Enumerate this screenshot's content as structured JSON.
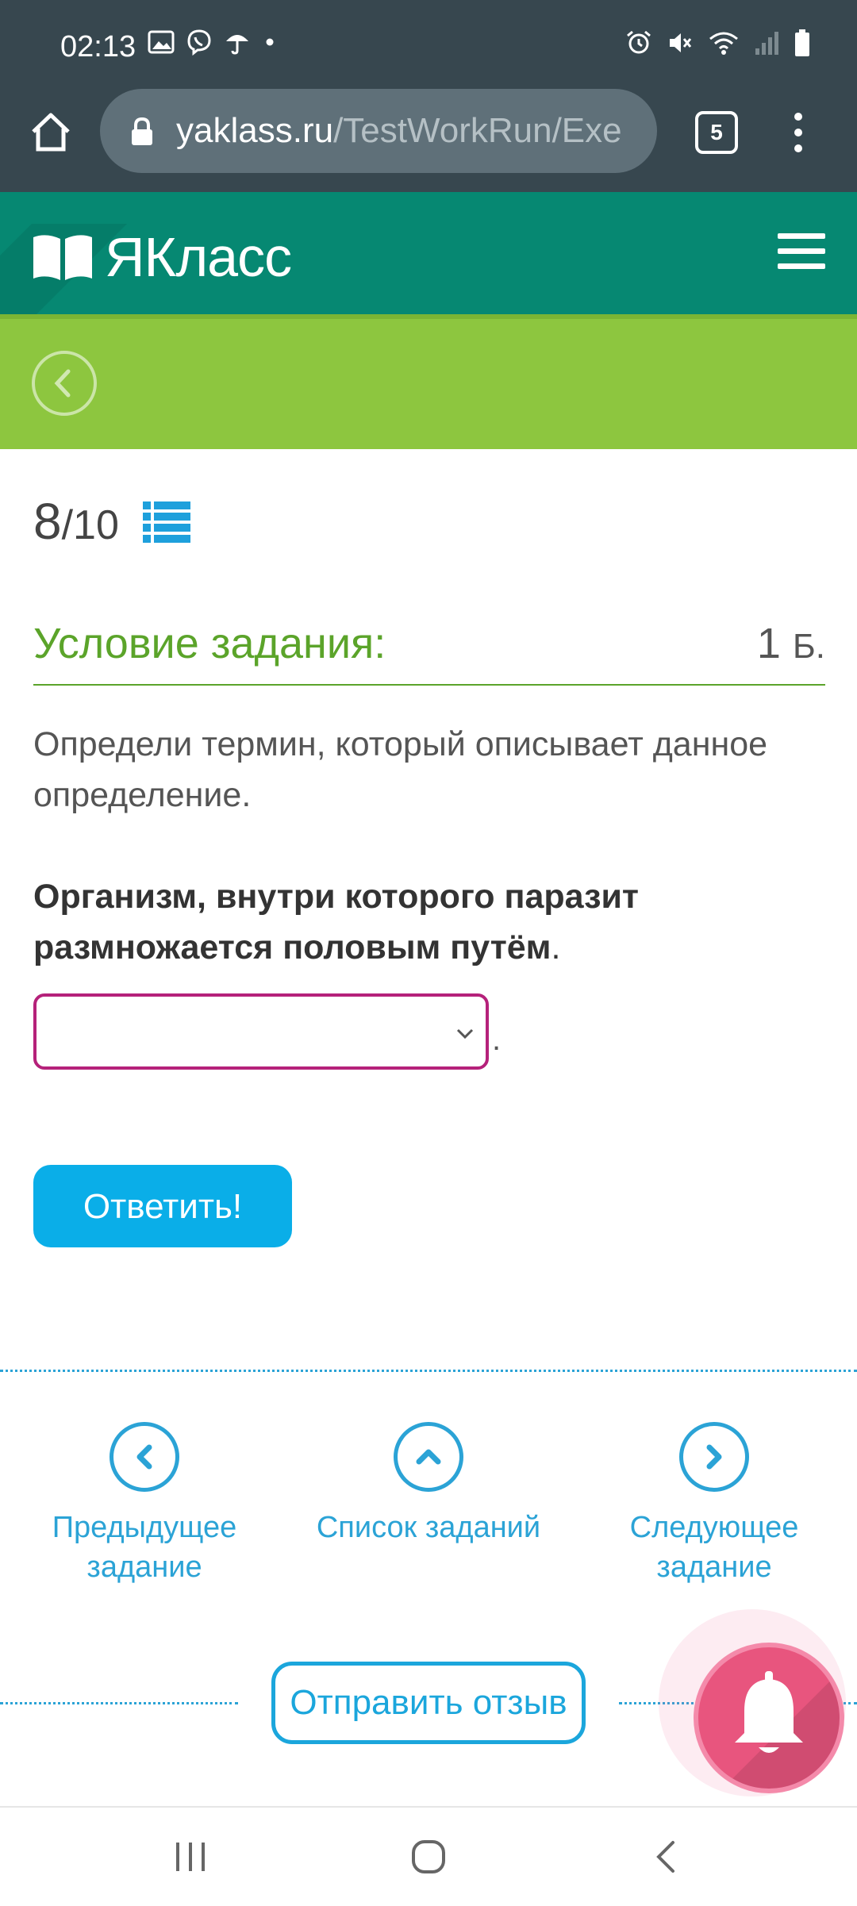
{
  "status_bar": {
    "time": "02:13",
    "left_icons": [
      "image-icon",
      "viber-icon",
      "umbrella-icon",
      "dot-icon"
    ],
    "right_icons": [
      "alarm-icon",
      "mute-icon",
      "wifi-icon",
      "signal-icon",
      "battery-icon"
    ]
  },
  "browser": {
    "url_domain": "yaklass.ru",
    "url_path": "/TestWorkRun/Exe",
    "tab_count": "5"
  },
  "site": {
    "brand": "ЯКласс"
  },
  "test": {
    "current": "8",
    "total": "/10",
    "condition_title": "Условие задания:",
    "points_value": "1",
    "points_unit": "Б.",
    "instruction": "Определи термин, который описывает данное определение.",
    "question": "Организм, внутри которого паразит размножается половым путём",
    "question_end": ".",
    "select_value": "",
    "after_select": ".",
    "answer_button": "Ответить!"
  },
  "nav": {
    "prev": "Предыдущее задание",
    "list": "Список заданий",
    "next": "Следующее задание",
    "feedback": "Отправить отзыв"
  },
  "colors": {
    "chrome": "#37474f",
    "header": "#068872",
    "subheader": "#8dc63f",
    "accent_green": "#5ba42a",
    "accent_blue": "#2ba3d6",
    "button_blue": "#0aaee8",
    "select_border": "#b5217a",
    "bell": "#e8557e"
  }
}
